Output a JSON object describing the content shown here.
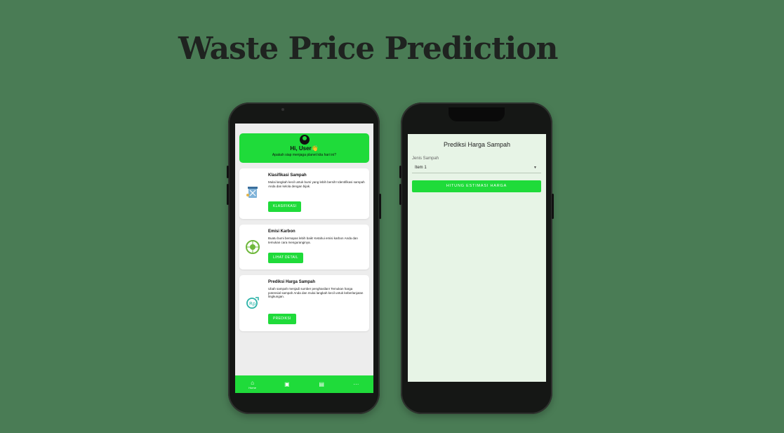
{
  "headline": "Waste Price Prediction",
  "home": {
    "avatar_icon": "user-circle-icon",
    "greeting": "Hi, User👋",
    "subtitle": "Apakah siap menjaga planet kita hari ini?",
    "cards": [
      {
        "title": "Klasifikasi Sampah",
        "description": "Mulai langkah kecil untuk bumi yang lebih bersih! Identifikasi sampah Anda dan kelola dengan bijak.",
        "button": "KLASIFIKASI",
        "icon": "trash-bin-icon"
      },
      {
        "title": "Emisi Karbon",
        "description": "Buatu bumi bernapas lebih baik! Ketahui emisi karbon Anda dan temukan cara menguranginya.",
        "button": "LIHAT DETAIL",
        "icon": "co2-icon"
      },
      {
        "title": "Prediksi Harga Sampah",
        "description": "Ubah sampah menjadi sumber penghasilan! Temukan harga potensial sampah Anda dan mulai langkah kecil untuk keberlanjutan lingkungan.",
        "button": "PREDIKSI",
        "icon": "recycle-money-icon"
      }
    ],
    "nav": [
      {
        "icon": "home-icon",
        "glyph": "⌂",
        "label": "Home"
      },
      {
        "icon": "map-icon",
        "glyph": "▣",
        "label": ""
      },
      {
        "icon": "list-icon",
        "glyph": "▤",
        "label": ""
      },
      {
        "icon": "more-icon",
        "glyph": "···",
        "label": ""
      }
    ]
  },
  "prediction": {
    "title": "Prediksi Harga Sampah",
    "field_label": "Jenis Sampah",
    "selected_item": "Item 1",
    "button": "HITUNG ESTIMASI HARGA"
  },
  "colors": {
    "background": "#4a7c55",
    "accent": "#1fdb3a"
  }
}
